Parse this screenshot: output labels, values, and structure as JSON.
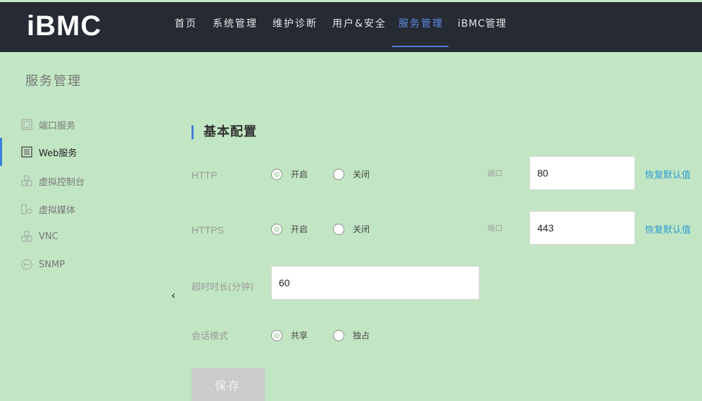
{
  "header": {
    "logo": "iBMC",
    "nav": [
      {
        "label": "首页"
      },
      {
        "label": "系统管理"
      },
      {
        "label": "维护诊断"
      },
      {
        "label": "用户&安全"
      },
      {
        "label": "服务管理"
      },
      {
        "label": "iBMC管理"
      }
    ],
    "active_nav": "服务管理"
  },
  "page_title": "服务管理",
  "sidebar": {
    "items": [
      {
        "label": "端口服务",
        "icon": "port-service-icon"
      },
      {
        "label": "Web服务",
        "icon": "web-service-icon"
      },
      {
        "label": "虚拟控制台",
        "icon": "virtual-console-icon"
      },
      {
        "label": "虚拟媒体",
        "icon": "virtual-media-icon"
      },
      {
        "label": "VNC",
        "icon": "vnc-icon"
      },
      {
        "label": "SNMP",
        "icon": "snmp-icon"
      }
    ],
    "active": "Web服务",
    "collapse_icon": "chevron-left-icon"
  },
  "form": {
    "section_title": "基本配置",
    "http": {
      "label": "HTTP",
      "option_on": "开启",
      "option_off": "关闭",
      "selected": "开启",
      "port_label": "端口",
      "port_value": "80",
      "restore_link": "恢复默认值"
    },
    "https": {
      "label": "HTTPS",
      "option_on": "开启",
      "option_off": "关闭",
      "selected": "开启",
      "port_label": "端口",
      "port_value": "443",
      "restore_link": "恢复默认值"
    },
    "timeout": {
      "label": "超时时长(分钟)",
      "value": "60"
    },
    "session_mode": {
      "label": "会话模式",
      "option_shared": "共享",
      "option_exclusive": "独占",
      "selected": "共享"
    },
    "save_label": "保存"
  },
  "colors": {
    "background": "#c2e6c3",
    "header_bg": "#262a33",
    "accent": "#4a7fd6",
    "link": "#2d9ad6"
  }
}
